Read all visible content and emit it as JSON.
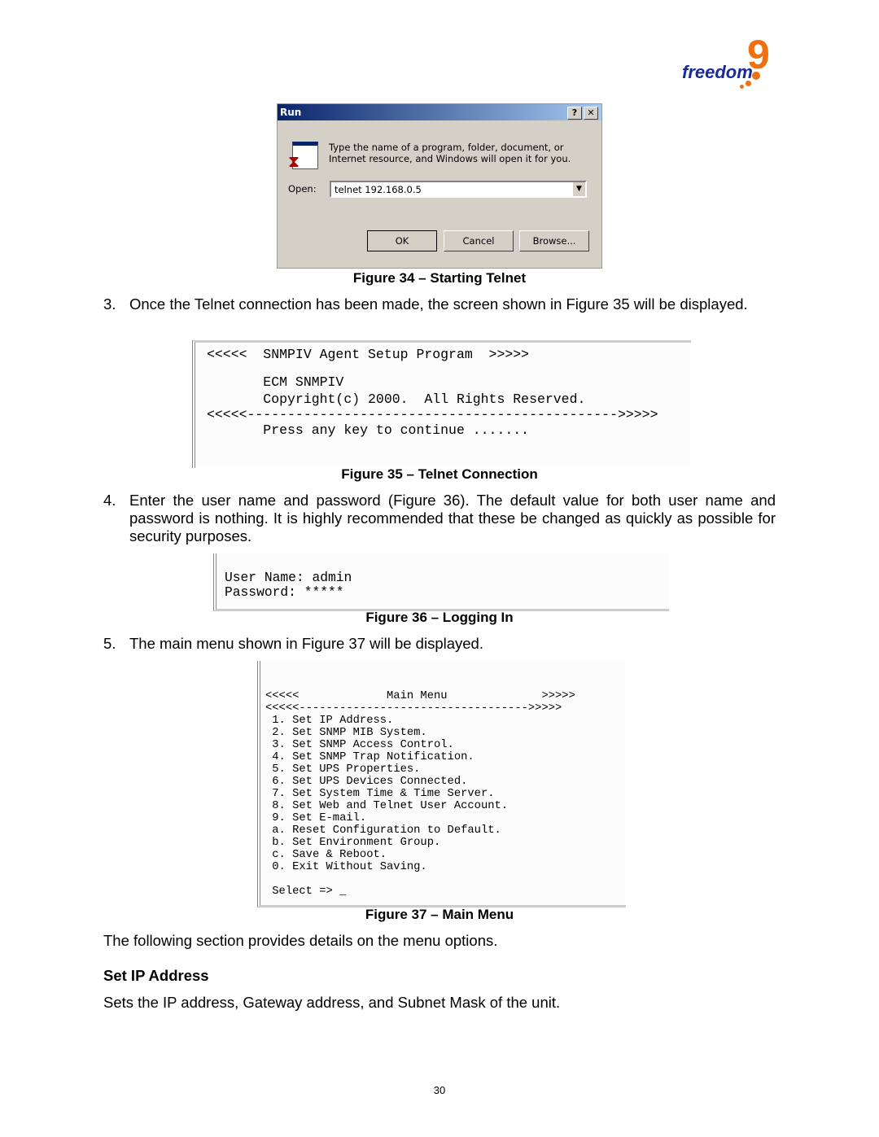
{
  "logo": {
    "text": "freedom",
    "mark": "9",
    "colors": {
      "word": "#1a2a9c",
      "mark": "#f07010"
    }
  },
  "figure34": {
    "dialog_title": "Run",
    "help_btn": "?",
    "close_btn": "✕",
    "description_line1": "Type the name of a program, folder, document, or",
    "description_line2": "Internet resource, and Windows will open it for you.",
    "open_label": "Open:",
    "open_value": "telnet 192.168.0.5",
    "ok": "OK",
    "cancel": "Cancel",
    "browse": "Browse...",
    "caption": "Figure 34 – Starting Telnet"
  },
  "step3": {
    "num": "3.",
    "text": "Once the Telnet connection has been made, the screen shown in Figure 35 will be displayed."
  },
  "figure35": {
    "lines": [
      "<<<<<  SNMPIV Agent Setup Program  >>>>>",
      "       ECM SNMPIV",
      "       Copyright(c) 2000.  All Rights Reserved.",
      "<<<<<---------------------------------------------->>>>>",
      "       Press any key to continue ......."
    ],
    "caption": "Figure 35 – Telnet Connection"
  },
  "step4": {
    "num": "4.",
    "text": "Enter the user name and password (Figure 36).  The default value for both user name and password is nothing.  It is highly recommended that these be changed as quickly as possible for security purposes."
  },
  "figure36": {
    "lines": [
      "User Name: admin",
      "Password: *****"
    ],
    "caption": "Figure 36 – Logging In"
  },
  "step5": {
    "num": "5.",
    "text": "The main menu shown in Figure 37 will be displayed."
  },
  "figure37": {
    "header": "<<<<<             Main Menu              >>>>>",
    "divider": "<<<<<---------------------------------->>>>>",
    "items": [
      " 1. Set IP Address.",
      " 2. Set SNMP MIB System.",
      " 3. Set SNMP Access Control.",
      " 4. Set SNMP Trap Notification.",
      " 5. Set UPS Properties.",
      " 6. Set UPS Devices Connected.",
      " 7. Set System Time & Time Server.",
      " 8. Set Web and Telnet User Account.",
      " 9. Set E-mail.",
      " a. Reset Configuration to Default.",
      " b. Set Environment Group.",
      " c. Save & Reboot.",
      " 0. Exit Without Saving."
    ],
    "prompt": " Select => _",
    "caption": "Figure 37 – Main Menu"
  },
  "intro": "The following section provides details on the menu options.",
  "section_heading": "Set IP Address",
  "section_text": "Sets the IP address, Gateway address, and Subnet Mask of the unit.",
  "page_number": "30"
}
